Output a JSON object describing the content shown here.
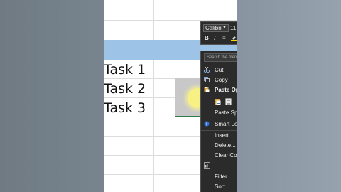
{
  "spreadsheet": {
    "cells": [
      "Task 1",
      "Task 2",
      "Task 3"
    ]
  },
  "mini_toolbar": {
    "font_name": "Calibri",
    "font_size": "11",
    "bold": "B",
    "italic": "I"
  },
  "context_menu": {
    "search_placeholder": "Search the menu",
    "items": [
      {
        "label": "Cut",
        "icon": "scissors-icon"
      },
      {
        "label": "Copy",
        "icon": "copy-icon"
      },
      {
        "label": "Paste Opt",
        "icon": "clipboard-icon"
      },
      {
        "label": "Paste Spec",
        "icon": ""
      },
      {
        "label": "Smart Loo",
        "icon": "info-icon"
      },
      {
        "label": "Insert...",
        "icon": ""
      },
      {
        "label": "Delete...",
        "icon": ""
      },
      {
        "label": "Clear Con",
        "icon": ""
      },
      {
        "label": "Filter",
        "icon": ""
      },
      {
        "label": "Sort",
        "icon": ""
      }
    ]
  },
  "colors": {
    "header_band": "#9dc3e6",
    "menu_bg": "#2b2b2b",
    "selection_border": "#2f7d46"
  }
}
